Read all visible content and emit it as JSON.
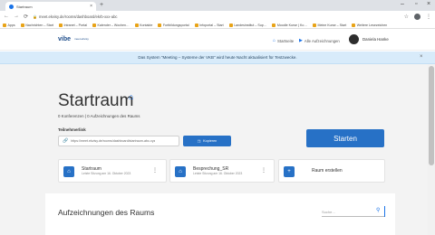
{
  "browser": {
    "tab_title": "Startraum",
    "new_tab": "+",
    "url": "meet.ekvisy.de/rooms/dashboard/ekrb-xxx-abc",
    "bookmarks": [
      "Apps",
      "Nachrichten – Start",
      "Intranet – Portal",
      "Kalender – Wochen…",
      "Kontakte",
      "Fortbildungsportal",
      "Infoportal – Start",
      "Landesinstitut – Sup…",
      "Moodle Kurse | Ko…",
      "Meine Kurse – Start",
      "Weitere Lesezeichen"
    ]
  },
  "app": {
    "logo": "vibe",
    "logo_sub": "meet.ekvisy",
    "nav_rooms": "Startseite",
    "nav_recordings": "Alle Aufzeichnungen",
    "user_name": "Daniela Hanke"
  },
  "notice": {
    "text": "Das System \"Meeting – Systeme der VKB\" wird heute Nacht aktualisiert für Testzwecke.",
    "close": "×"
  },
  "room": {
    "title": "Startraum",
    "meta": "0 Konferenzen | 0 Aufzeichnungen des Raums",
    "link_label": "Teilnehmerlink",
    "link_value": "https://meet.ekvisy.de/rooms/dashboard/startraum-abc-xyz",
    "copy_label": "Kopieren",
    "start_label": "Starten"
  },
  "cards": [
    {
      "title": "Startraum",
      "sub": "Letzte Sitzung am 16. Oktober 2023",
      "badge": "⌂"
    },
    {
      "title": "Besprechung_SR",
      "sub": "Letzte Sitzung am 16. Oktober 2023",
      "badge": "⌂"
    }
  ],
  "new_room": {
    "label": "Raum erstellen",
    "badge": "+"
  },
  "recordings": {
    "title": "Aufzeichnungen des Raums",
    "search_placeholder": "Suche…"
  }
}
